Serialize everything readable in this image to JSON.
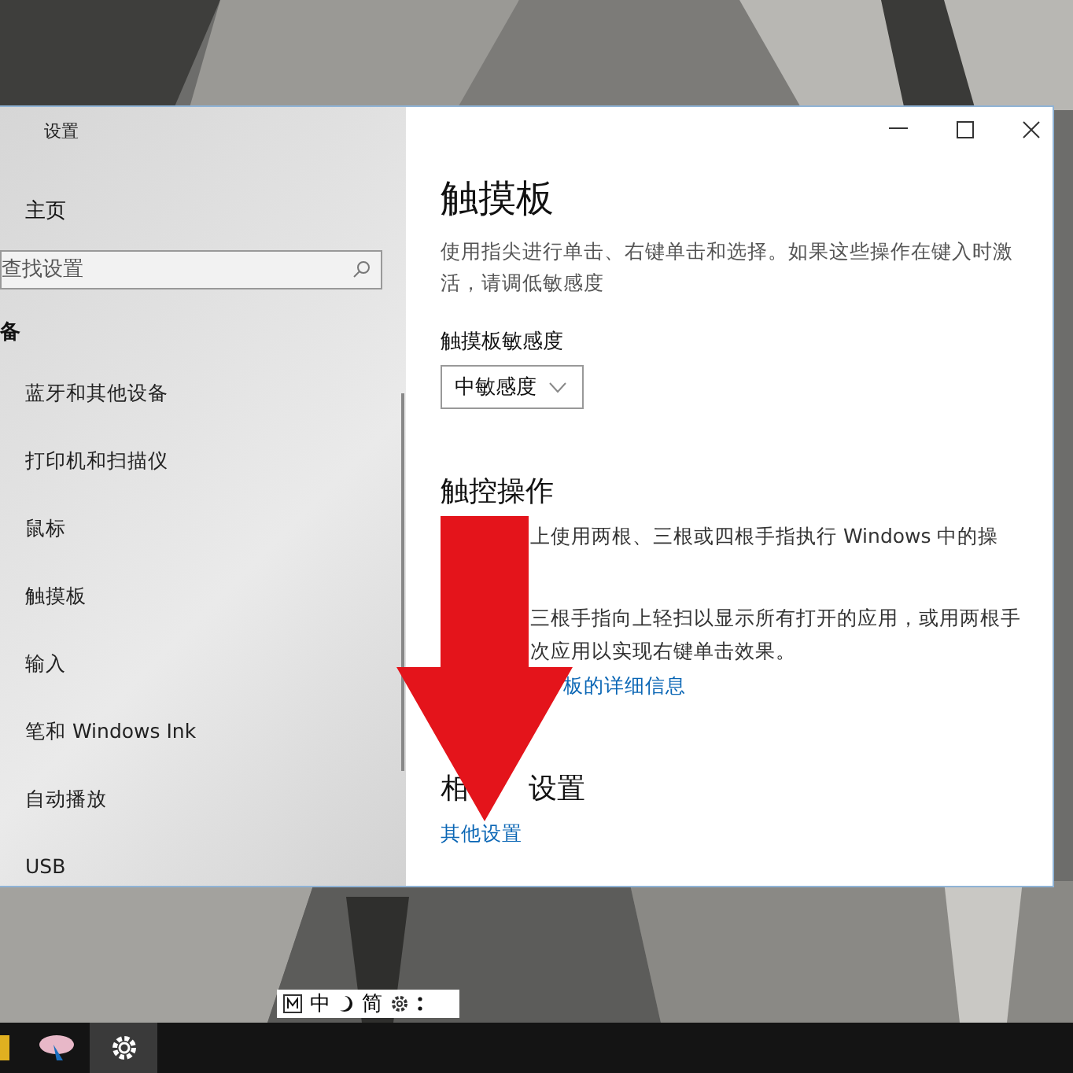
{
  "window": {
    "title": "设置"
  },
  "sidebar": {
    "home": "主页",
    "search": {
      "placeholder": "查找设置"
    },
    "section": "备",
    "items": [
      "蓝牙和其他设备",
      "打印机和扫描仪",
      "鼠标",
      "触摸板",
      "输入",
      "笔和 Windows Ink",
      "自动播放",
      "USB"
    ]
  },
  "content": {
    "title": "触摸板",
    "description": "使用指尖进行单击、右键单击和选择。如果这些操作在键入时激活，请调低敏感度",
    "sensitivity": {
      "label": "触摸板敏感度",
      "value": "中敏感度"
    },
    "gestures": {
      "heading": "触控操作",
      "lines": [
        "上使用两根、三根或四根手指执行 Windows 中的操",
        "三根手指向上轻扫以显示所有打开的应用，或用两根手",
        "次应用以实现右键单击效果。"
      ],
      "link": "板的详细信息"
    },
    "related": {
      "heading_parts": [
        "相",
        "设置"
      ],
      "link": "其他设置"
    }
  },
  "ime_bar": {
    "items": [
      "中",
      "简"
    ]
  }
}
